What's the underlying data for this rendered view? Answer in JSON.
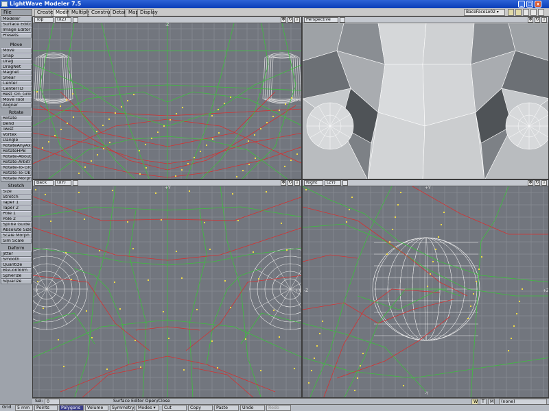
{
  "window": {
    "title": "LightWave Modeler 7.5"
  },
  "menu": {
    "file": "File"
  },
  "tabs": [
    "Create",
    "Modify",
    "Multiply",
    "Construct",
    "Detail",
    "Map",
    "Display"
  ],
  "active_tab": "Modify",
  "layer": {
    "name": "BaceFaceLo02 ▾"
  },
  "sidebar": {
    "top_buttons": [
      "Modeler",
      "Surface Editor",
      "Image Editor",
      "Presets"
    ],
    "sections": [
      {
        "header": "Move",
        "items": [
          "Move",
          "Snap",
          "Drag",
          "DragNet",
          "Magnet",
          "Shear",
          "Center",
          "CenterTD",
          "Rest_On_Ground",
          "Move Tool",
          "Aligner"
        ]
      },
      {
        "header": "Rotate",
        "items": [
          "Rotate",
          "Bend",
          "Twist",
          "Vortex",
          "Dangle",
          "RotateAnyAxis",
          "RotateHPB",
          "Rotate-About-",
          "Rotate-Arbitrar",
          "Rotate-To-Grou",
          "Rotate-To-Obje",
          "Rotate Morph"
        ]
      },
      {
        "header": "Stretch",
        "items": [
          "Size",
          "Stretch",
          "Taper 1",
          "Taper 2",
          "Pole 1",
          "Pole 2",
          "Spline Guide",
          "Absolute Size",
          "Scale Morph",
          "Sim Scale"
        ]
      },
      {
        "header": "Deform",
        "items": [
          "Jitter",
          "Smooth",
          "Quantize",
          "BGConform",
          "Spherize",
          "Squarize"
        ]
      }
    ]
  },
  "viewports": [
    {
      "view": "Top",
      "axes": "(XZ)",
      "type": "wire",
      "axis_labels": {
        "top": "-Z",
        "right": "+X",
        "left": "-X"
      }
    },
    {
      "view": "Perspective",
      "axes": "",
      "type": "shaded",
      "axis_labels": {}
    },
    {
      "view": "Back",
      "axes": "(XY)",
      "type": "wire",
      "axis_labels": {
        "top": "+Y",
        "right": "+X",
        "left": "-X"
      }
    },
    {
      "view": "Right",
      "axes": "(ZY)",
      "type": "wire",
      "axis_labels": {
        "top": "+Y",
        "right": "+Z",
        "left": "-Z",
        "bottom": "-Y"
      }
    }
  ],
  "status": {
    "sel_label": "Sel:",
    "sel_value": "0",
    "message": "Surface Editor Open/Close",
    "grid_label": "Grid",
    "grid_value": "5 mm",
    "modes": [
      "Points",
      "Polygons",
      "Volume"
    ],
    "active_mode": "Polygons",
    "buttons": [
      "Symmetry",
      "Modes ▾",
      "Cut",
      "Copy",
      "Paste",
      "Undo",
      "Redo"
    ],
    "wtm": [
      "W",
      "T",
      "M"
    ],
    "surface": "(none)"
  },
  "colors": {
    "viewport_bg": "#72767e",
    "grid": "#83878e",
    "wire_green": "#3cc03c",
    "wire_red": "#d63030",
    "wire_white": "#f0f0f0",
    "titlebar": "#0a3db8"
  },
  "icons": [
    "move-icon",
    "rotate-icon",
    "zoom-icon",
    "maximize-icon",
    "minimize-icon",
    "close-icon"
  ]
}
